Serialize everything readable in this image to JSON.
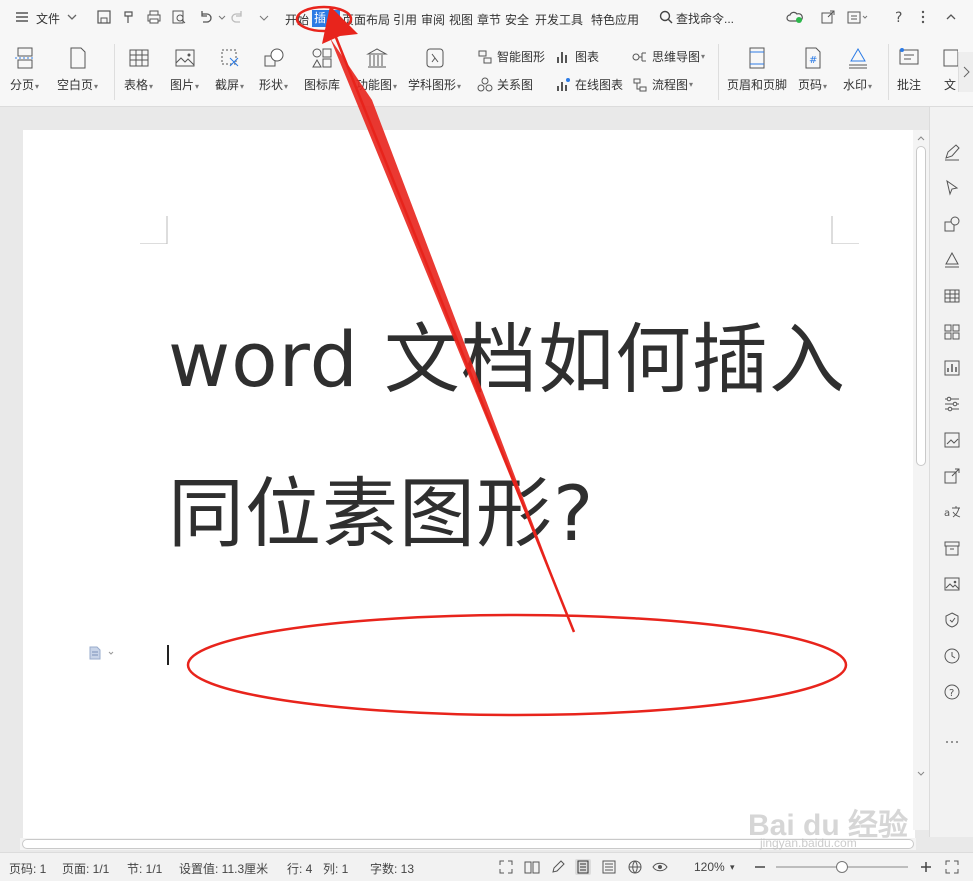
{
  "menu": {
    "file_label": "文件",
    "tabs": [
      {
        "label": "开始"
      },
      {
        "label": "插入",
        "active": true
      },
      {
        "label": "页面布局"
      },
      {
        "label": "引用"
      },
      {
        "label": "审阅"
      },
      {
        "label": "视图"
      },
      {
        "label": "章节"
      },
      {
        "label": "安全"
      },
      {
        "label": "开发工具"
      },
      {
        "label": "特色应用"
      }
    ],
    "search_label": "查找命令..."
  },
  "ribbon": {
    "page_break": "分页",
    "blank_page": "空白页",
    "table": "表格",
    "picture": "图片",
    "screenshot": "截屏",
    "shape": "形状",
    "icon_library": "图标库",
    "function_chart": "功能图",
    "subject_chart": "学科图形",
    "smart_shape": "智能图形",
    "relation_chart": "关系图",
    "chart": "图表",
    "online_chart": "在线图表",
    "mind_map": "思维导图",
    "flow_chart": "流程图",
    "header_footer": "页眉和页脚",
    "page_number": "页码",
    "watermark": "水印",
    "comment": "批注",
    "text_partial": "文"
  },
  "document": {
    "title_line1": "word 文档如何插入",
    "title_line2": "同位素图形?"
  },
  "status": {
    "page_num": "页码: 1",
    "pages": "页面: 1/1",
    "section": "节: 1/1",
    "setting": "设置值: 11.3厘米",
    "row": "行: 4",
    "col": "列: 1",
    "word_count": "字数: 13",
    "zoom": "120%"
  },
  "watermark": {
    "brand": "Bai du 经验",
    "url": "jingyan.baidu.com"
  },
  "colors": {
    "accent": "#2c7be5",
    "annotation": "#e8241c"
  }
}
